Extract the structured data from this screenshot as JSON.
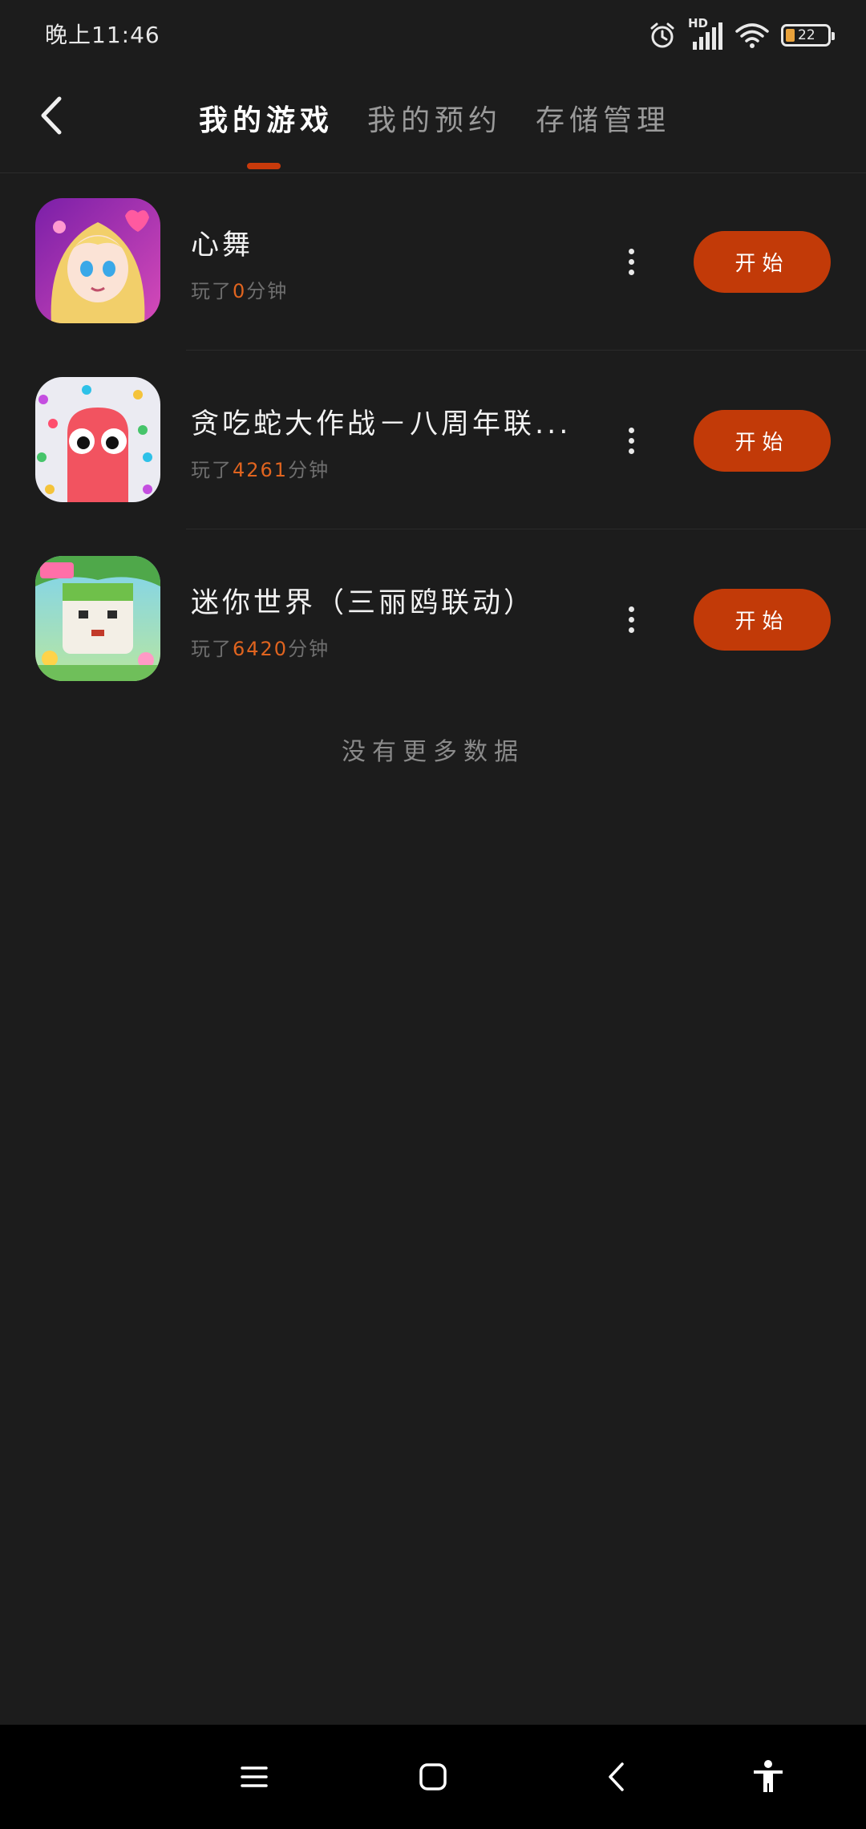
{
  "status_bar": {
    "time": "晚上11:46",
    "network": "HD",
    "battery": "22",
    "icons": [
      "alarm-icon",
      "signal-icon",
      "wifi-icon",
      "battery-icon"
    ]
  },
  "header": {
    "tabs": [
      {
        "label": "我的游戏",
        "active": true
      },
      {
        "label": "我的预约",
        "active": false
      },
      {
        "label": "存储管理",
        "active": false
      }
    ]
  },
  "games": [
    {
      "title": "心舞",
      "sub_prefix": "玩了",
      "minutes": "0",
      "sub_suffix": "分钟",
      "action": "开始",
      "icon": "anime-girl-game-icon"
    },
    {
      "title": "贪吃蛇大作战－八周年联...",
      "sub_prefix": "玩了",
      "minutes": "4261",
      "sub_suffix": "分钟",
      "action": "开始",
      "icon": "snake-game-icon"
    },
    {
      "title": "迷你世界（三丽鸥联动）",
      "sub_prefix": "玩了",
      "minutes": "6420",
      "sub_suffix": "分钟",
      "action": "开始",
      "icon": "mini-world-game-icon"
    }
  ],
  "footer_text": "没有更多数据",
  "colors": {
    "accent": "#c23a08",
    "background": "#1c1c1c",
    "minutes": "#e0641f"
  },
  "nav_bar": {
    "icons": [
      "menu-icon",
      "home-icon",
      "back-icon",
      "accessibility-icon"
    ]
  }
}
